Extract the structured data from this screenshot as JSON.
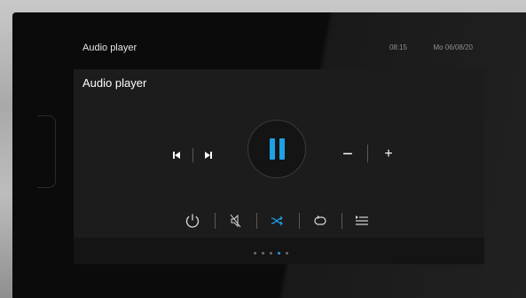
{
  "window": {
    "title": "Audio player",
    "time": "08:15",
    "date": "Mo 06/08/20"
  },
  "panel": {
    "title": "Audio player"
  },
  "controls": {
    "previous_icon": "skip-previous-icon",
    "next_icon": "skip-next-icon",
    "play_pause_icon": "pause-icon",
    "volume_down": "−",
    "volume_up": "+",
    "accent_color": "#1ea0e6"
  },
  "bottom_controls": {
    "power_icon": "power-icon",
    "mute_icon": "mute-icon",
    "shuffle_icon": "shuffle-icon",
    "repeat_icon": "repeat-icon",
    "playlist_icon": "playlist-icon"
  },
  "pager": {
    "total": 5,
    "active": 4
  }
}
